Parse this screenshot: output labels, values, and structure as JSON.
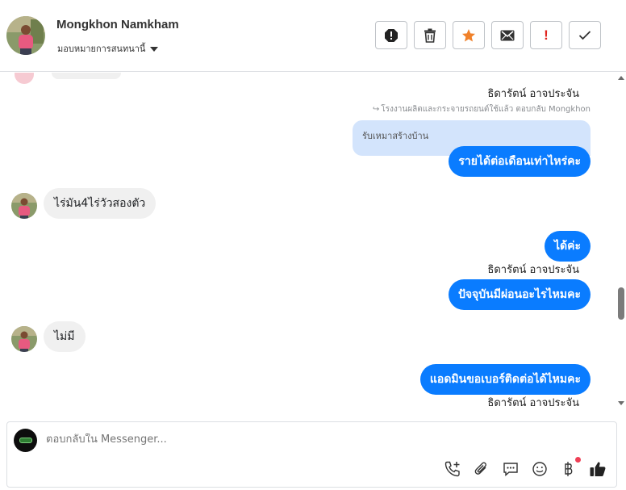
{
  "header": {
    "contact_name": "Mongkhon Namkham",
    "assign_label": "มอบหมายการสนทนานี้",
    "actions": [
      {
        "name": "report-spam-button",
        "icon": "alert-octagon-icon"
      },
      {
        "name": "delete-button",
        "icon": "trash-icon"
      },
      {
        "name": "star-button",
        "icon": "star-icon"
      },
      {
        "name": "mark-unread-button",
        "icon": "envelope-icon"
      },
      {
        "name": "mark-important-button",
        "icon": "exclamation-icon",
        "label": "!"
      },
      {
        "name": "mark-done-button",
        "icon": "check-icon"
      }
    ]
  },
  "conversation": {
    "messages": [
      {
        "id": "m1",
        "sender": "ธิดารัตน์ อาจประจัน",
        "reply_note": "โรงงานผลิตและกระจายรถยนต์ใช้แล้ว ตอบกลับ Mongkhon",
        "quoted_text": "รับเหมาสร้างบ้าน",
        "text": "รายได้ต่อเดือนเท่าไหร่คะ",
        "direction": "outgoing"
      },
      {
        "id": "m2",
        "text": "ไร่มัน4ไร่วัวสองตัว",
        "direction": "incoming"
      },
      {
        "id": "m3",
        "text": "ได้ค่ะ",
        "direction": "outgoing"
      },
      {
        "id": "m4",
        "sender": "ธิดารัตน์ อาจประจัน",
        "text": "ปัจจุบันมีผ่อนอะไรไหมคะ",
        "direction": "outgoing"
      },
      {
        "id": "m5",
        "text": "ไม่มี",
        "direction": "incoming"
      },
      {
        "id": "m6",
        "text": "แอดมินขอเบอร์ติดต่อได้ไหมคะ",
        "direction": "outgoing"
      },
      {
        "id": "m7",
        "sender": "ธิดารัตน์ อาจประจัน",
        "direction": "outgoing"
      }
    ]
  },
  "composer": {
    "placeholder": "ตอบกลับใน Messenger...",
    "tools": [
      "add-call-icon",
      "attachment-icon",
      "saved-replies-icon",
      "emoji-icon",
      "baht-payment-icon",
      "like-icon"
    ]
  },
  "colors": {
    "outgoing_bubble": "#0a7cff",
    "quoted_bubble": "#d3e4fc",
    "incoming_bubble": "#f0f0f0",
    "star": "#f0812a",
    "important": "#e0241f"
  }
}
